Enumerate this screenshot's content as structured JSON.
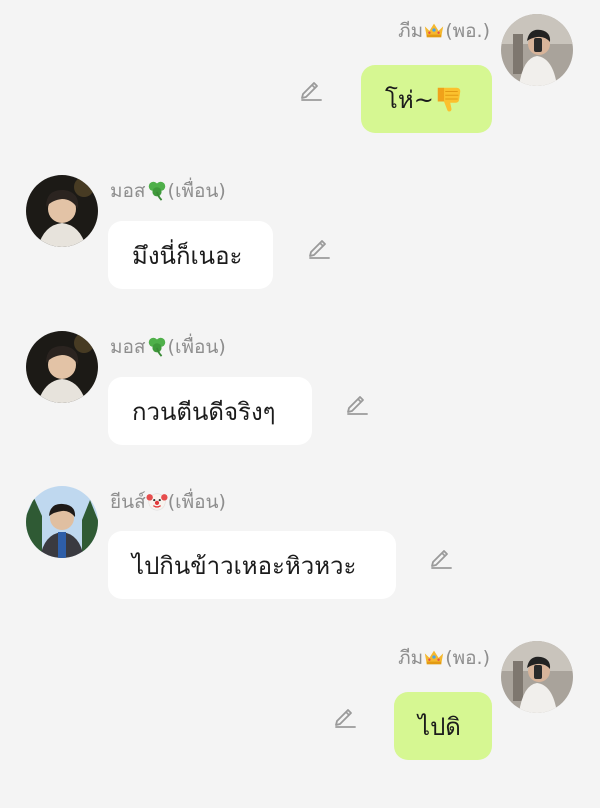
{
  "messages": [
    {
      "side": "right",
      "sender": {
        "name": "ภีม",
        "emoji_icon": "crown-icon",
        "suffix": "(พอ.)"
      },
      "text": "โห่~",
      "text_emoji_icon": "thumbs-down-icon",
      "edit_icon": "pencil-icon"
    },
    {
      "side": "left",
      "sender": {
        "name": "มอส",
        "emoji_icon": "shamrock-icon",
        "suffix": "(เพื่อน)"
      },
      "text": "มึงนี่ก็เนอะ",
      "edit_icon": "pencil-icon"
    },
    {
      "side": "left",
      "sender": {
        "name": "มอส",
        "emoji_icon": "shamrock-icon",
        "suffix": "(เพื่อน)"
      },
      "text": "กวนตีนดีจริงๆ",
      "edit_icon": "pencil-icon"
    },
    {
      "side": "left",
      "sender": {
        "name": "ยีนส์",
        "emoji_icon": "clown-icon",
        "suffix": "(เพื่อน)"
      },
      "text": "ไปกินข้าวเหอะหิวหวะ",
      "edit_icon": "pencil-icon"
    },
    {
      "side": "right",
      "sender": {
        "name": "ภีม",
        "emoji_icon": "crown-icon",
        "suffix": "(พอ.)"
      },
      "text": "ไปดิ",
      "edit_icon": "pencil-icon"
    }
  ],
  "colors": {
    "background": "#f4f4f4",
    "own_bubble": "#d6f792",
    "other_bubble": "#ffffff",
    "name_text": "#8e8e8e",
    "message_text": "#1b1b1b"
  }
}
